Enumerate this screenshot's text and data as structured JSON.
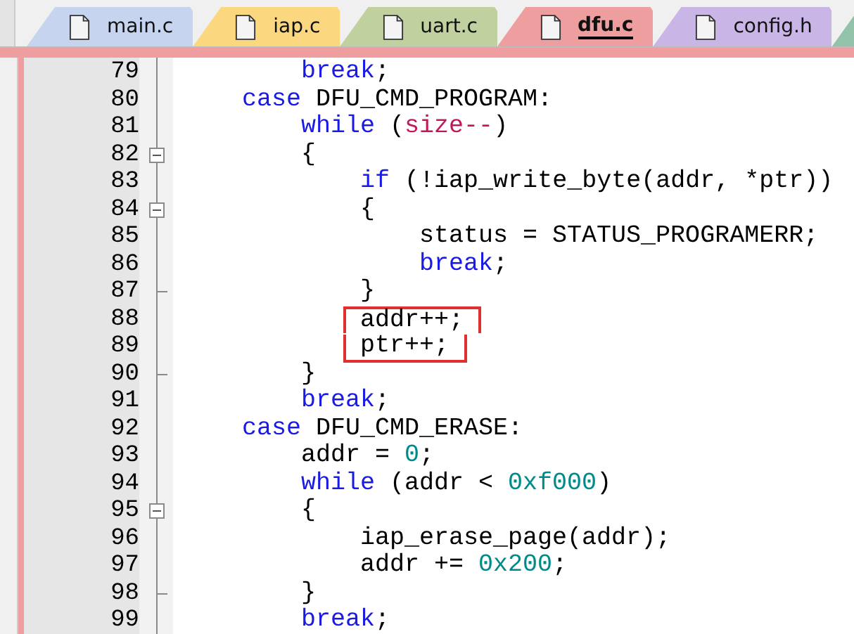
{
  "tabs": [
    {
      "label": "main.c",
      "color": "#c6d4f0",
      "selected": false
    },
    {
      "label": "iap.c",
      "color": "#fbd780",
      "selected": false
    },
    {
      "label": "uart.c",
      "color": "#c0d09e",
      "selected": false
    },
    {
      "label": "dfu.c",
      "color": "#ee9e9e",
      "selected": true
    },
    {
      "label": "config.h",
      "color": "#c9b6e6",
      "selected": false
    },
    {
      "color": "#93c2ab",
      "selected": false
    }
  ],
  "editor": {
    "lines": [
      {
        "number": "79",
        "collapsible": false,
        "block_end": false,
        "highlighted": false,
        "tokens": [
          {
            "kind": "keyword",
            "text": "        break"
          },
          {
            "kind": "plain",
            "text": ";"
          }
        ]
      },
      {
        "number": "80",
        "collapsible": false,
        "block_end": false,
        "highlighted": false,
        "tokens": [
          {
            "kind": "keyword",
            "text": "    case"
          },
          {
            "kind": "plain",
            "text": " DFU_CMD_PROGRAM:"
          }
        ]
      },
      {
        "number": "81",
        "collapsible": false,
        "block_end": false,
        "highlighted": false,
        "tokens": [
          {
            "kind": "keyword",
            "text": "        while"
          },
          {
            "kind": "plain",
            "text": " ("
          },
          {
            "kind": "variable",
            "text": "size--"
          },
          {
            "kind": "plain",
            "text": ")"
          }
        ]
      },
      {
        "number": "82",
        "collapsible": true,
        "block_end": false,
        "highlighted": false,
        "tokens": [
          {
            "kind": "plain",
            "text": "        {"
          }
        ]
      },
      {
        "number": "83",
        "collapsible": false,
        "block_end": false,
        "highlighted": false,
        "tokens": [
          {
            "kind": "keyword",
            "text": "            if"
          },
          {
            "kind": "plain",
            "text": " (!iap_write_byte(addr, *ptr))"
          }
        ]
      },
      {
        "number": "84",
        "collapsible": true,
        "block_end": false,
        "highlighted": false,
        "tokens": [
          {
            "kind": "plain",
            "text": "            {"
          }
        ]
      },
      {
        "number": "85",
        "collapsible": false,
        "block_end": false,
        "highlighted": false,
        "tokens": [
          {
            "kind": "plain",
            "text": "                status = STATUS_PROGRAMERR;"
          }
        ]
      },
      {
        "number": "86",
        "collapsible": false,
        "block_end": false,
        "highlighted": false,
        "tokens": [
          {
            "kind": "keyword",
            "text": "                break"
          },
          {
            "kind": "plain",
            "text": ";"
          }
        ]
      },
      {
        "number": "87",
        "collapsible": false,
        "block_end": true,
        "highlighted": false,
        "tokens": [
          {
            "kind": "plain",
            "text": "            }"
          }
        ]
      },
      {
        "number": "88",
        "collapsible": false,
        "block_end": false,
        "highlighted": true,
        "tokens": [
          {
            "kind": "plain",
            "text": "            addr++;"
          }
        ]
      },
      {
        "number": "89",
        "collapsible": false,
        "block_end": false,
        "highlighted": true,
        "tokens": [
          {
            "kind": "plain",
            "text": "            ptr++;"
          }
        ]
      },
      {
        "number": "90",
        "collapsible": false,
        "block_end": true,
        "highlighted": false,
        "tokens": [
          {
            "kind": "plain",
            "text": "        }"
          }
        ]
      },
      {
        "number": "91",
        "collapsible": false,
        "block_end": false,
        "highlighted": false,
        "tokens": [
          {
            "kind": "keyword",
            "text": "        break"
          },
          {
            "kind": "plain",
            "text": ";"
          }
        ]
      },
      {
        "number": "92",
        "collapsible": false,
        "block_end": false,
        "highlighted": false,
        "tokens": [
          {
            "kind": "keyword",
            "text": "    case"
          },
          {
            "kind": "plain",
            "text": " DFU_CMD_ERASE:"
          }
        ]
      },
      {
        "number": "93",
        "collapsible": false,
        "block_end": false,
        "highlighted": false,
        "tokens": [
          {
            "kind": "plain",
            "text": "        addr = "
          },
          {
            "kind": "number",
            "text": "0"
          },
          {
            "kind": "plain",
            "text": ";"
          }
        ]
      },
      {
        "number": "94",
        "collapsible": false,
        "block_end": false,
        "highlighted": false,
        "tokens": [
          {
            "kind": "keyword",
            "text": "        while"
          },
          {
            "kind": "plain",
            "text": " (addr < "
          },
          {
            "kind": "number",
            "text": "0xf000"
          },
          {
            "kind": "plain",
            "text": ")"
          }
        ]
      },
      {
        "number": "95",
        "collapsible": true,
        "block_end": false,
        "highlighted": false,
        "tokens": [
          {
            "kind": "plain",
            "text": "        {"
          }
        ]
      },
      {
        "number": "96",
        "collapsible": false,
        "block_end": false,
        "highlighted": false,
        "tokens": [
          {
            "kind": "plain",
            "text": "            iap_erase_page(addr);"
          }
        ]
      },
      {
        "number": "97",
        "collapsible": false,
        "block_end": false,
        "highlighted": false,
        "tokens": [
          {
            "kind": "plain",
            "text": "            addr += "
          },
          {
            "kind": "number",
            "text": "0x200"
          },
          {
            "kind": "plain",
            "text": ";"
          }
        ]
      },
      {
        "number": "98",
        "collapsible": false,
        "block_end": true,
        "highlighted": false,
        "tokens": [
          {
            "kind": "plain",
            "text": "        }"
          }
        ]
      },
      {
        "number": "99",
        "collapsible": false,
        "block_end": false,
        "highlighted": false,
        "tokens": [
          {
            "kind": "keyword",
            "text": "        break"
          },
          {
            "kind": "plain",
            "text": ";"
          }
        ]
      }
    ]
  }
}
